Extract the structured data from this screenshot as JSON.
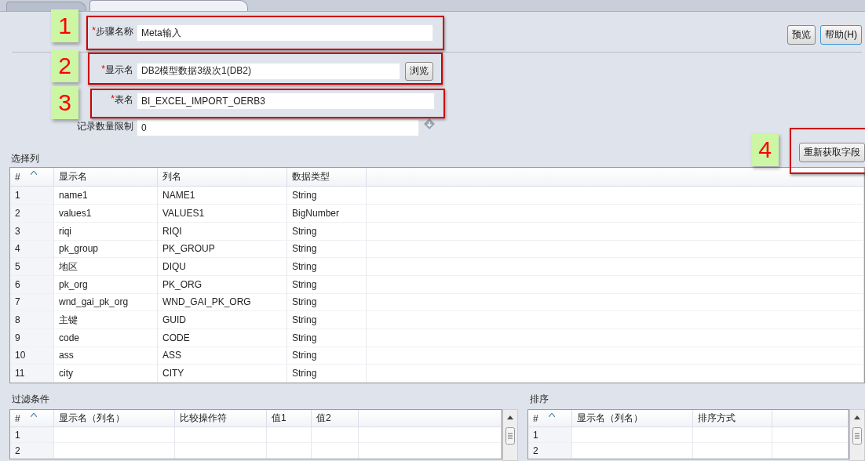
{
  "tabs": [
    {
      "selected": false
    },
    {
      "selected": true
    }
  ],
  "form": {
    "step_name": {
      "label": "步骤名称",
      "required_mark": "*",
      "value": "Meta输入"
    },
    "display_name": {
      "label": "显示名",
      "required_mark": "*",
      "value": "DB2模型数据3级次1(DB2)",
      "button": "浏览"
    },
    "table_name": {
      "label": "表名",
      "required_mark": "*",
      "value": "BI_EXCEL_IMPORT_OERB3"
    },
    "record_limit": {
      "label": "记录数量限制",
      "value": "0"
    }
  },
  "buttons": [
    "预览",
    "帮助(H)"
  ],
  "refetch_button": "重新获取字段",
  "columns_section": {
    "title": "选择列",
    "columns": [
      "#",
      "显示名",
      "列名",
      "数据类型"
    ],
    "rows": [
      [
        "1",
        "name1",
        "NAME1",
        "String"
      ],
      [
        "2",
        "values1",
        "VALUES1",
        "BigNumber"
      ],
      [
        "3",
        "riqi",
        "RIQI",
        "String"
      ],
      [
        "4",
        "pk_group",
        "PK_GROUP",
        "String"
      ],
      [
        "5",
        "地区",
        "DIQU",
        "String"
      ],
      [
        "6",
        "pk_org",
        "PK_ORG",
        "String"
      ],
      [
        "7",
        "wnd_gai_pk_org",
        "WND_GAI_PK_ORG",
        "String"
      ],
      [
        "8",
        "主键",
        "GUID",
        "String"
      ],
      [
        "9",
        "code",
        "CODE",
        "String"
      ],
      [
        "10",
        "ass",
        "ASS",
        "String"
      ],
      [
        "11",
        "city",
        "CITY",
        "String"
      ]
    ]
  },
  "filter_section": {
    "title": "过滤条件",
    "columns": [
      "#",
      "显示名（列名）",
      "比较操作符",
      "值1",
      "值2"
    ],
    "rows": [
      "1",
      "2"
    ]
  },
  "sort_section": {
    "title": "排序",
    "columns": [
      "#",
      "显示名（列名）",
      "排序方式"
    ],
    "rows": [
      "1",
      "2"
    ]
  },
  "annotations": [
    {
      "label": "1"
    },
    {
      "label": "2"
    },
    {
      "label": "3"
    },
    {
      "label": "4"
    }
  ]
}
